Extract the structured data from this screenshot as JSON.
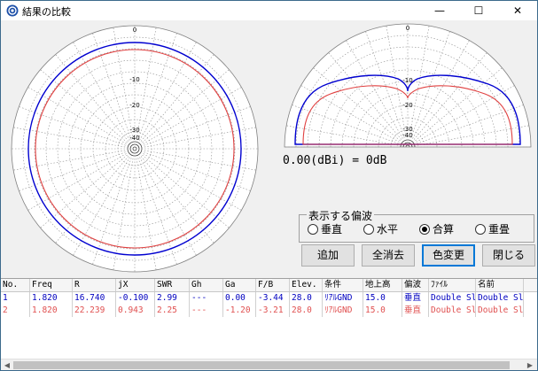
{
  "window": {
    "title": "結果の比較",
    "controls": {
      "minimize": "—",
      "maximize": "☐",
      "close": "✕"
    }
  },
  "plot": {
    "full_labels": [
      "0",
      "-10",
      "-20",
      "-30",
      "-40"
    ],
    "half_labels": [
      "0",
      "-10",
      "-20",
      "-30",
      "-40"
    ],
    "colors": {
      "series1": "#0000d0",
      "series2": "#e04040",
      "grid": "#909090"
    }
  },
  "gain_readout": "0.00(dBi) = 0dB",
  "polarization": {
    "legend": "表示する偏波",
    "options": [
      {
        "label": "垂直",
        "selected": false
      },
      {
        "label": "水平",
        "selected": false
      },
      {
        "label": "合算",
        "selected": true
      },
      {
        "label": "重畳",
        "selected": false
      }
    ]
  },
  "buttons": {
    "add": "追加",
    "clear_all": "全消去",
    "color_change": "色変更",
    "close": "閉じる"
  },
  "table": {
    "headers": [
      "No.",
      "Freq",
      "R",
      "jX",
      "SWR",
      "Gh",
      "Ga",
      "F/B",
      "Elev.",
      "条件",
      "地上高",
      "偏波",
      "ﾌｧｲﾙ",
      "名前"
    ],
    "rows": [
      [
        "1",
        "1.820",
        "16.740",
        "-0.100",
        "2.99",
        "---",
        "0.00",
        "-3.44",
        "28.0",
        "ﾘｱﾙGND",
        "15.0",
        "垂直",
        "Double Slo",
        "Double Sl"
      ],
      [
        "2",
        "1.820",
        "22.239",
        "0.943",
        "2.25",
        "---",
        "-1.20",
        "-3.21",
        "28.0",
        "ﾘｱﾙGND",
        "15.0",
        "垂直",
        "Double Slo",
        "Double Sl"
      ]
    ]
  }
}
